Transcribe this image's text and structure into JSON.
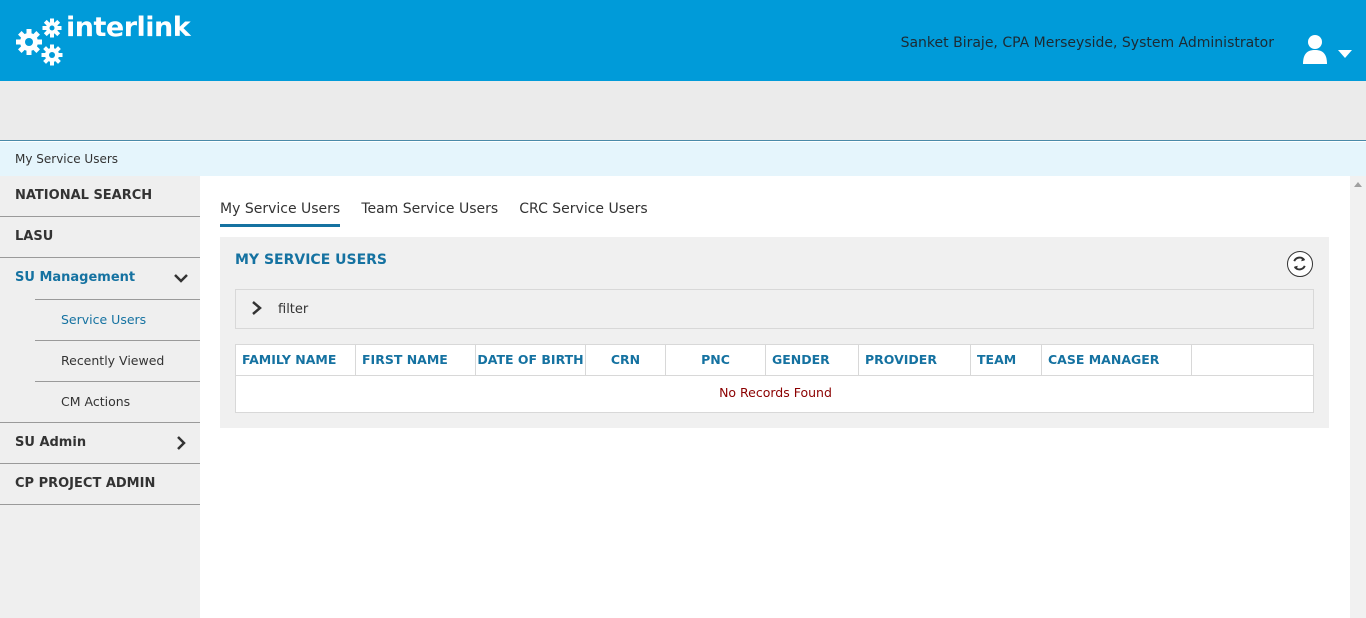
{
  "header": {
    "logo_text": "interlink",
    "user_label": "Sanket Biraje, CPA Merseyside, System Administrator",
    "brand_color": "#009bd9"
  },
  "breadcrumb": "My Service Users",
  "sidebar": {
    "items": [
      {
        "label": "NATIONAL SEARCH"
      },
      {
        "label": "LASU"
      },
      {
        "label": "SU Management",
        "expanded": true,
        "icon": "chevron-down-icon"
      },
      {
        "label": "SU Admin",
        "icon": "chevron-right-icon"
      },
      {
        "label": "CP PROJECT ADMIN"
      }
    ],
    "sub_items": [
      {
        "label": "Service Users",
        "selected": true
      },
      {
        "label": "Recently Viewed"
      },
      {
        "label": "CM Actions"
      }
    ]
  },
  "tabs": [
    {
      "label": "My Service Users",
      "active": true
    },
    {
      "label": "Team Service Users"
    },
    {
      "label": "CRC Service Users"
    }
  ],
  "panel": {
    "title": "MY SERVICE USERS",
    "filter_label": "filter",
    "columns": [
      "FAMILY NAME",
      "FIRST NAME",
      "DATE OF BIRTH",
      "CRN",
      "PNC",
      "GENDER",
      "PROVIDER",
      "TEAM",
      "CASE MANAGER",
      ""
    ],
    "empty_message": "No Records Found"
  }
}
